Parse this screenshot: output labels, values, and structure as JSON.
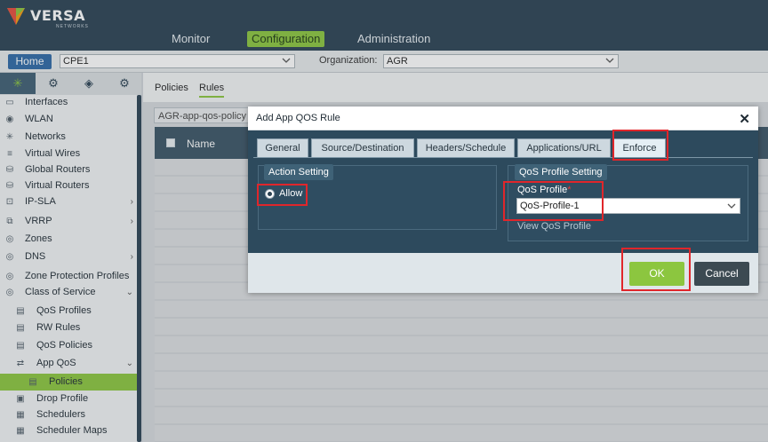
{
  "app": {
    "brand": "VERSA",
    "brand_sub": "NETWORKS"
  },
  "topnav": {
    "tabs": [
      {
        "label": "Monitor"
      },
      {
        "label": "Configuration"
      },
      {
        "label": "Administration"
      }
    ],
    "active": "Configuration"
  },
  "subbar": {
    "home_label": "Home",
    "device_value": "CPE1",
    "org_label": "Organization:",
    "org_value": "AGR"
  },
  "sidebar": {
    "icons": [
      "network-icon",
      "gear-icon",
      "cube-icon",
      "globe-gear-icon"
    ],
    "items": [
      {
        "label": "Interfaces",
        "icon": "interfaces-icon"
      },
      {
        "label": "WLAN",
        "icon": "wifi-icon"
      },
      {
        "label": "Networks",
        "icon": "networks-icon"
      },
      {
        "label": "Virtual Wires",
        "icon": "wires-icon"
      },
      {
        "label": "Global Routers",
        "icon": "router-icon"
      },
      {
        "label": "Virtual Routers",
        "icon": "router-icon"
      },
      {
        "label": "IP-SLA",
        "icon": "sla-icon",
        "arrow": ">"
      },
      {
        "label": "VRRP",
        "icon": "vrrp-icon",
        "arrow": ">"
      },
      {
        "label": "Zones",
        "icon": "zones-icon"
      },
      {
        "label": "DNS",
        "icon": "dns-icon",
        "arrow": ">"
      },
      {
        "label": "Zone Protection Profiles",
        "icon": "shield-icon"
      },
      {
        "label": "Class of Service",
        "icon": "cos-icon",
        "arrow": "v"
      },
      {
        "label": "QoS Profiles",
        "icon": "doc-icon"
      },
      {
        "label": "RW Rules",
        "icon": "doc-icon"
      },
      {
        "label": "QoS Policies",
        "icon": "doc-icon"
      },
      {
        "label": "App QoS",
        "icon": "app-icon",
        "arrow": "v"
      },
      {
        "label": "Policies",
        "icon": "doc-icon"
      },
      {
        "label": "Drop Profile",
        "icon": "drop-icon"
      },
      {
        "label": "Schedulers",
        "icon": "calendar-icon"
      },
      {
        "label": "Scheduler Maps",
        "icon": "map-icon"
      }
    ]
  },
  "main": {
    "tabs": [
      {
        "label": "Policies"
      },
      {
        "label": "Rules"
      }
    ],
    "active_tab": "Rules",
    "breadcrumb": "AGR-app-qos-policy",
    "grid": {
      "columns": [
        "Name"
      ]
    }
  },
  "modal": {
    "title": "Add App QOS Rule",
    "tabs": [
      {
        "label": "General"
      },
      {
        "label": "Source/Destination"
      },
      {
        "label": "Headers/Schedule"
      },
      {
        "label": "Applications/URL"
      },
      {
        "label": "Enforce"
      }
    ],
    "active_tab": "Enforce",
    "action_setting": {
      "title": "Action Setting",
      "option": "Allow",
      "selected": true
    },
    "qos_profile_setting": {
      "title": "QoS Profile Setting",
      "field_label": "QoS Profile",
      "required_mark": "*",
      "value": "QoS-Profile-1",
      "link": "View QoS Profile"
    },
    "buttons": {
      "ok": "OK",
      "cancel": "Cancel"
    }
  },
  "colors": {
    "header_bg": "#2b4354",
    "accent_green": "#8cc63f",
    "modal_body_bg": "#2d4a5d",
    "highlight_red": "#e0262b"
  }
}
